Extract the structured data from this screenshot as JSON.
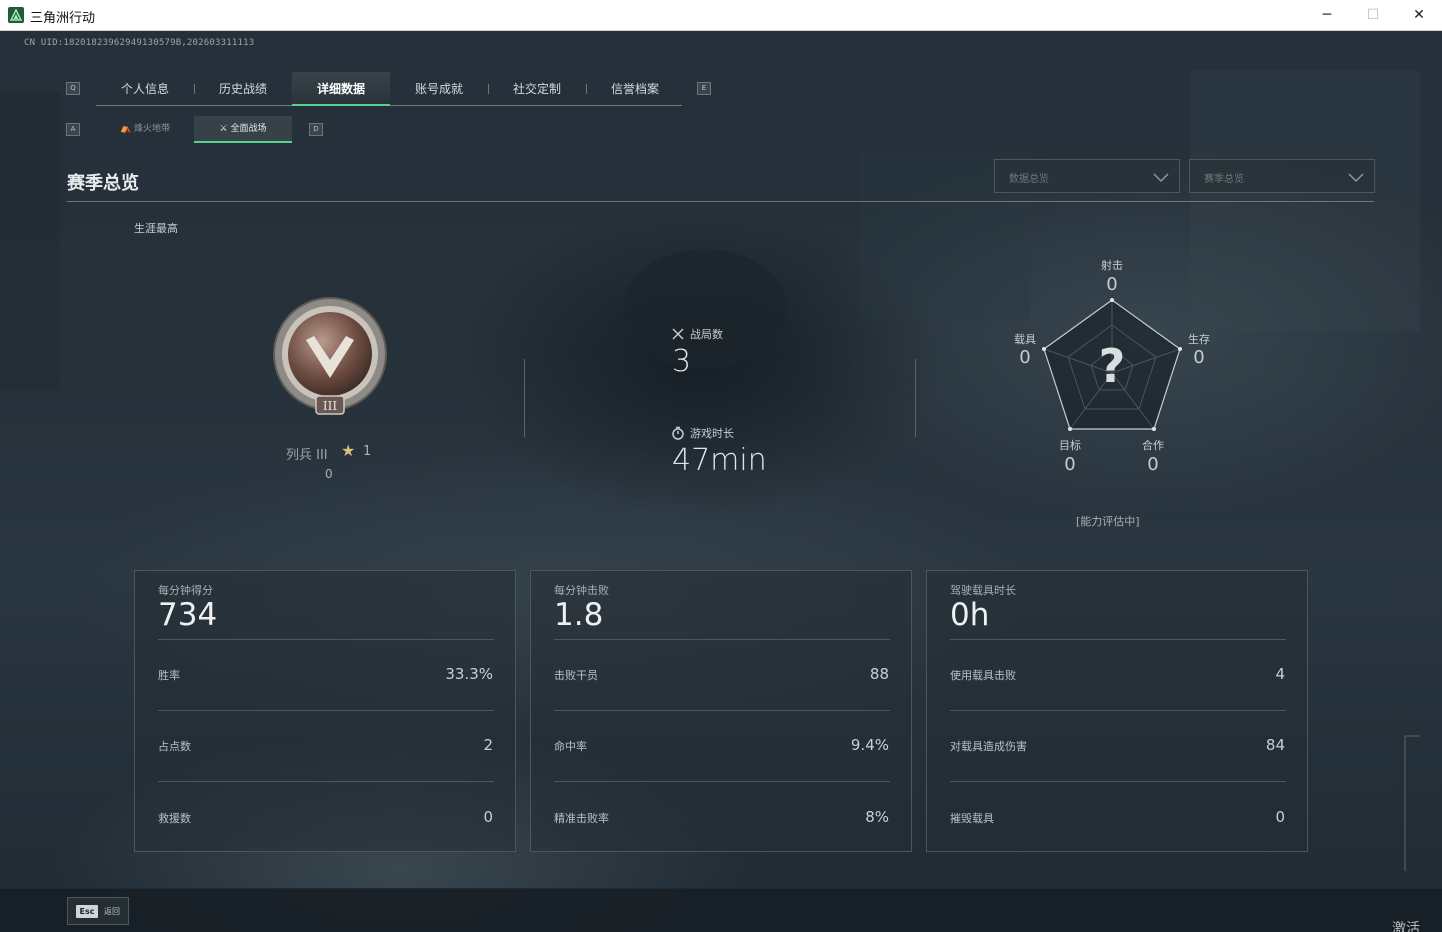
{
  "window": {
    "title": "三角洲行动",
    "min": "─",
    "max": "☐",
    "close": "✕"
  },
  "uid": "CN UID:18201823962949130579B,202603311113",
  "nav": {
    "prev_key": "Q",
    "next_key": "E",
    "tabs": [
      "个人信息",
      "历史战绩",
      "详细数据",
      "账号成就",
      "社交定制",
      "信誉档案"
    ],
    "active_tab": "详细数据",
    "sub_prev_key": "A",
    "sub_next_key": "D",
    "sub_tabs": [
      "烽火地带",
      "全面战场"
    ],
    "active_sub_tab": "全面战场"
  },
  "section": {
    "title": "赛季总览"
  },
  "filters": {
    "left": "数据总览",
    "right": "赛季总览"
  },
  "career": {
    "label": "生涯最高",
    "rank_name": "列兵 III",
    "stars": "1",
    "points": "0"
  },
  "summary": {
    "matches_label": "战局数",
    "matches": "3",
    "playtime_label": "游戏时长",
    "playtime": "47min"
  },
  "radar": {
    "shooting_label": "射击",
    "shooting": "0",
    "survival_label": "生存",
    "survival": "0",
    "vehicle_label": "载具",
    "vehicle": "0",
    "objective_label": "目标",
    "objective": "0",
    "coop_label": "合作",
    "coop": "0",
    "center": "?",
    "note": "[能力评估中]",
    "values": [
      0,
      0,
      0,
      0,
      0
    ]
  },
  "cards": [
    {
      "title": "每分钟得分",
      "value": "734",
      "rows": [
        {
          "label": "胜率",
          "value": "33.3%"
        },
        {
          "label": "占点数",
          "value": "2"
        },
        {
          "label": "救援数",
          "value": "0"
        }
      ]
    },
    {
      "title": "每分钟击败",
      "value": "1.8",
      "rows": [
        {
          "label": "击败干员",
          "value": "88"
        },
        {
          "label": "命中率",
          "value": "9.4%"
        },
        {
          "label": "精准击败率",
          "value": "8%"
        }
      ]
    },
    {
      "title": "驾驶载具时长",
      "value": "0h",
      "rows": [
        {
          "label": "使用载具击败",
          "value": "4"
        },
        {
          "label": "对载具造成伤害",
          "value": "84"
        },
        {
          "label": "摧毁载具",
          "value": "0"
        }
      ]
    }
  ],
  "footer": {
    "esc_key": "Esc",
    "back_label": "返回",
    "corner": "激活"
  },
  "colors": {
    "accent": "#5ad08a",
    "background": "#26313a"
  }
}
